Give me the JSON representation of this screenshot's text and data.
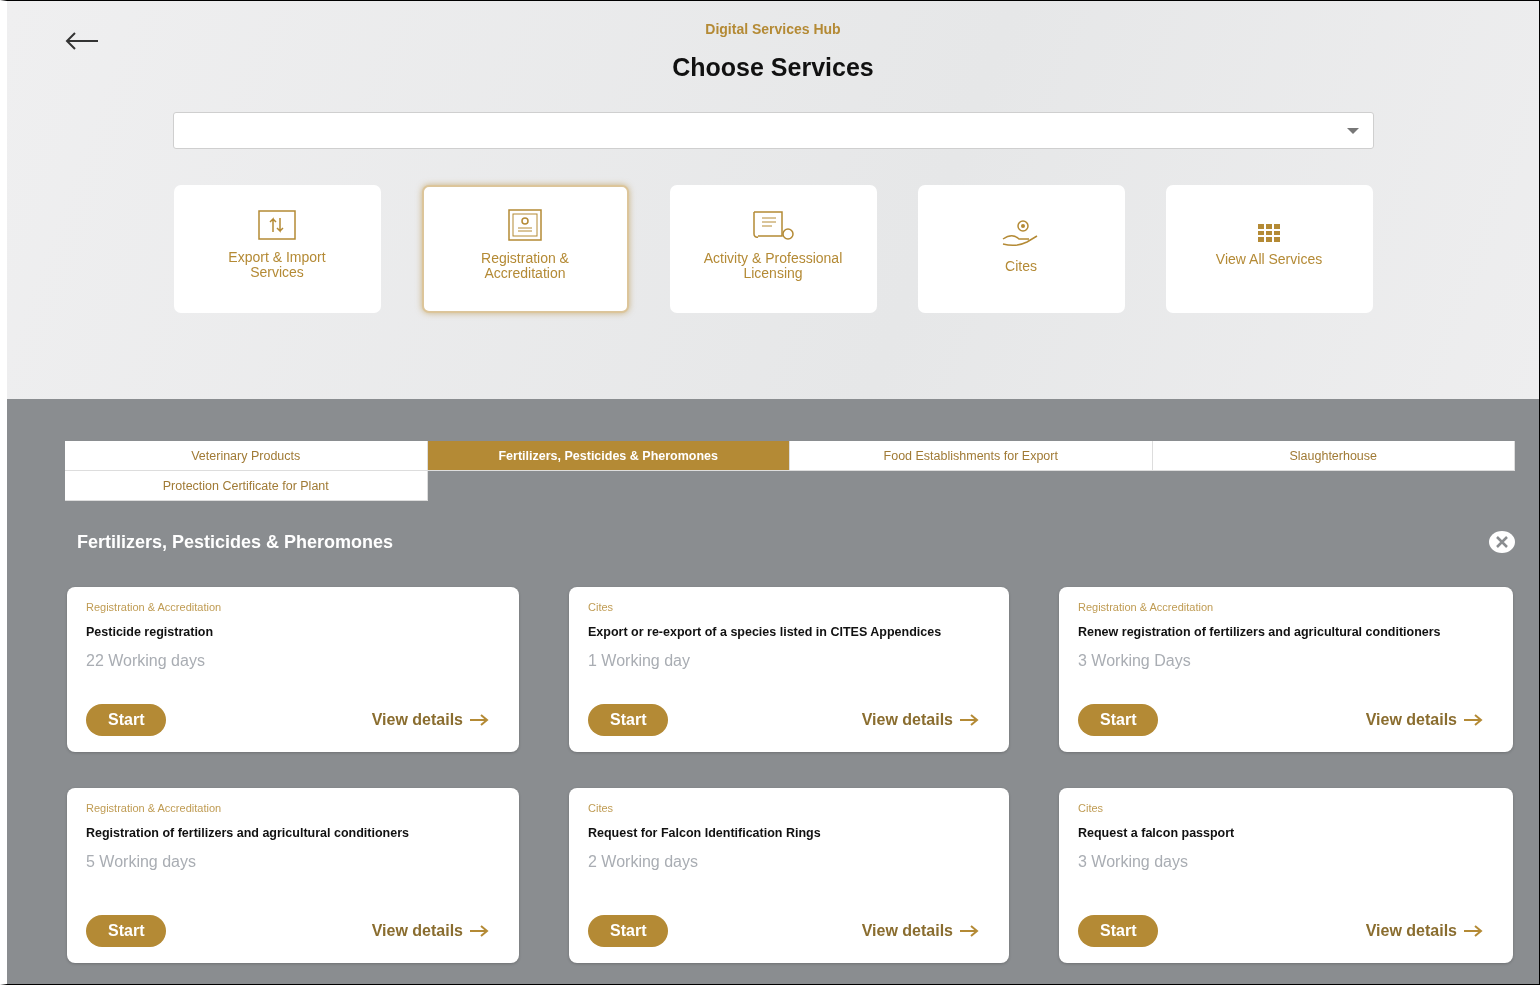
{
  "header": {
    "subtitle": "Digital Services Hub",
    "title": "Choose Services"
  },
  "categories": [
    {
      "label": "Export & Import Services",
      "selected": false
    },
    {
      "label": "Registration & Accreditation",
      "selected": true
    },
    {
      "label": "Activity & Professional Licensing",
      "selected": false
    },
    {
      "label": "Cites",
      "selected": false
    },
    {
      "label": "View All Services",
      "selected": false
    }
  ],
  "tabs": [
    {
      "label": "Veterinary Products",
      "selected": false
    },
    {
      "label": "Fertilizers, Pesticides & Pheromones",
      "selected": true
    },
    {
      "label": "Food Establishments for Export",
      "selected": false
    },
    {
      "label": "Slaughterhouse",
      "selected": false
    },
    {
      "label": "Protection Certificate for Plant",
      "selected": false
    }
  ],
  "section_title": "Fertilizers, Pesticides & Pheromones",
  "services": [
    {
      "category": "Registration & Accreditation",
      "name": "Pesticide registration",
      "duration": "22 Working days",
      "start": "Start",
      "details": "View details"
    },
    {
      "category": "Cites",
      "name": "Export or re-export of a species listed in CITES Appendices",
      "duration": "1 Working day",
      "start": "Start",
      "details": "View details"
    },
    {
      "category": "Registration & Accreditation",
      "name": "Renew registration of fertilizers and agricultural conditioners",
      "duration": "3 Working Days",
      "start": "Start",
      "details": "View details"
    },
    {
      "category": "Registration & Accreditation",
      "name": "Registration of fertilizers and agricultural conditioners",
      "duration": "5 Working days",
      "start": "Start",
      "details": "View details"
    },
    {
      "category": "Cites",
      "name": "Request for Falcon Identification Rings",
      "duration": "2 Working days",
      "start": "Start",
      "details": "View details"
    },
    {
      "category": "Cites",
      "name": "Request a falcon passport",
      "duration": "3 Working days",
      "start": "Start",
      "details": "View details"
    }
  ]
}
